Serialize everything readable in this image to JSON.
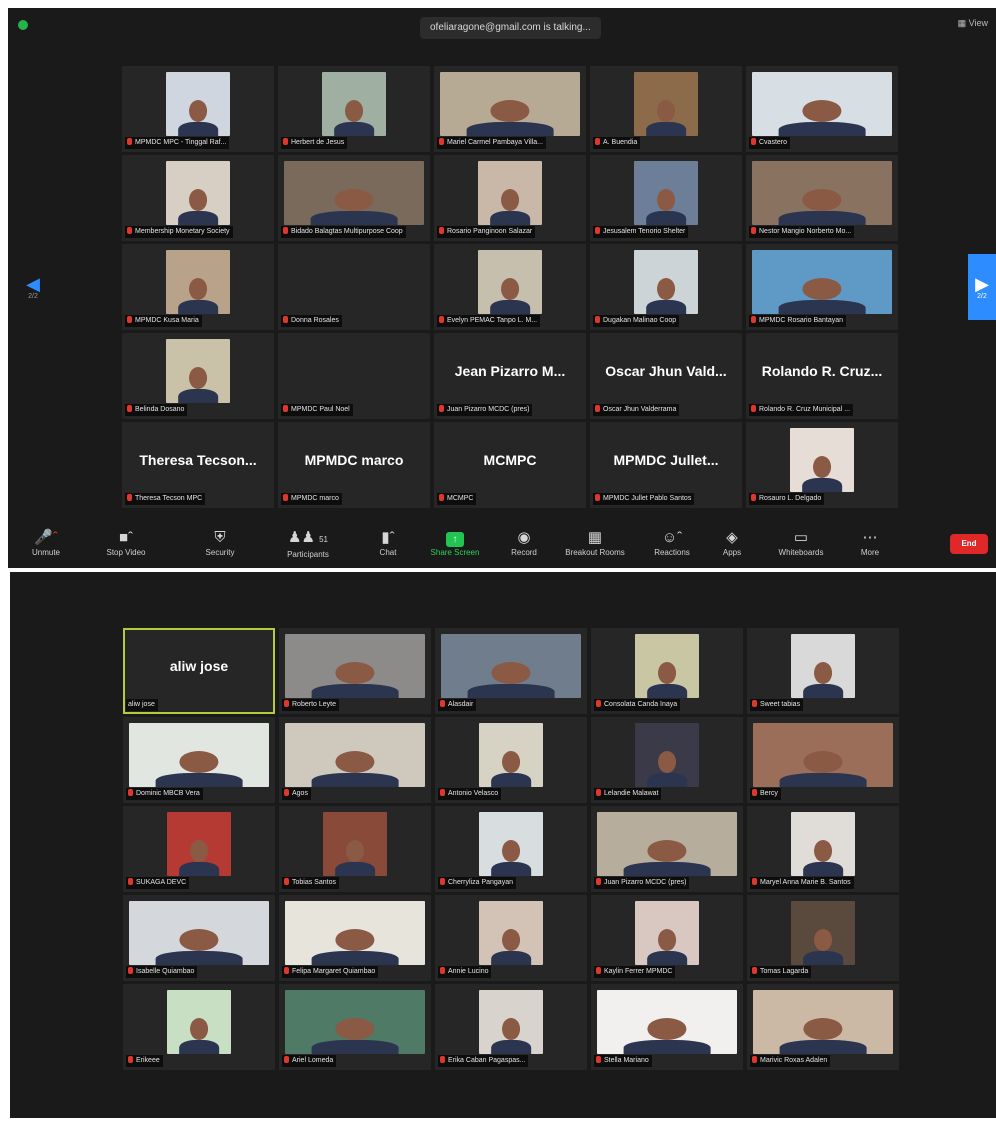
{
  "meeting": {
    "speaking_indicator": "ofeliaragone@gmail.com is talking...",
    "view_label": "View",
    "page_left": "2/2",
    "page_right": "2/2"
  },
  "toolbar": {
    "unmute": "Unmute",
    "stop_video": "Stop Video",
    "security": "Security",
    "participants": "Participants",
    "participants_count": "51",
    "chat": "Chat",
    "share_screen": "Share Screen",
    "record": "Record",
    "breakout_rooms": "Breakout Rooms",
    "reactions": "Reactions",
    "apps": "Apps",
    "whiteboards": "Whiteboards",
    "more": "More",
    "end": "End"
  },
  "screen1_tiles": [
    {
      "name": "MPMDC MPC - Tinggal Raf...",
      "video": true,
      "bg": "#cfd6df"
    },
    {
      "name": "Herbert de Jesus",
      "video": true,
      "bg": "#9fb0a2"
    },
    {
      "name": "Mariel Carmel Pambaya Villa...",
      "video": true,
      "bg": "#b7aa95",
      "wide": true
    },
    {
      "name": "A. Buendia",
      "video": true,
      "bg": "#8c6b4a"
    },
    {
      "name": "Cvastero",
      "video": true,
      "bg": "#d7dee4",
      "wide": true
    },
    {
      "name": "Membership Monetary Society",
      "video": true,
      "bg": "#d8cfc4"
    },
    {
      "name": "Bidado Balagtas Multipurpose Coop",
      "video": true,
      "bg": "#7a6a5c",
      "wide": true
    },
    {
      "name": "Rosario Panginoon Salazar",
      "video": true,
      "bg": "#c9b8a8"
    },
    {
      "name": "Jesusalem Tenorio Shelter",
      "video": true,
      "bg": "#6d7f98"
    },
    {
      "name": "Nestor Mangio Norberto Mo...",
      "video": true,
      "bg": "#8a7260",
      "wide": true
    },
    {
      "name": "MPMDC Kusa Maria",
      "video": true,
      "bg": "#b9a28a"
    },
    {
      "name": "Donna Rosales",
      "video": false
    },
    {
      "name": "Evelyn PEMAC Tanpo L. M...",
      "video": true,
      "bg": "#c7bfae"
    },
    {
      "name": "Dugakan Malinao Coop",
      "video": true,
      "bg": "#cdd4d8"
    },
    {
      "name": "MPMDC Rosario Bantayan",
      "video": true,
      "bg": "#5f9ac6",
      "wide": true
    },
    {
      "name": "Belinda Dosano",
      "video": true,
      "bg": "#c9c1a8"
    },
    {
      "name": "MPMDC Paul Noel",
      "video": false
    },
    {
      "name": "Juan Pizarro MCDC (pres)",
      "big": "Jean Pizarro M..."
    },
    {
      "name": "Oscar Jhun Valderrama",
      "big": "Oscar Jhun Vald..."
    },
    {
      "name": "Rolando R. Cruz Municipal ...",
      "big": "Rolando R. Cruz..."
    },
    {
      "name": "Theresa Tecson MPC",
      "big": "Theresa Tecson..."
    },
    {
      "name": "MPMDC marco",
      "big": "MPMDC marco"
    },
    {
      "name": "MCMPC",
      "big": "MCMPC"
    },
    {
      "name": "MPMDC Jullet Pablo Santos",
      "big": "MPMDC Jullet..."
    },
    {
      "name": "Rosauro L. Delgado",
      "video": true,
      "bg": "#e6ddd6"
    }
  ],
  "screen2_tiles": [
    {
      "name": "aliw jose",
      "big": "aliw jose",
      "active": true
    },
    {
      "name": "Roberto Leyte",
      "video": true,
      "bg": "#8d8a8a",
      "wide": true
    },
    {
      "name": "Alasdair",
      "video": true,
      "bg": "#6f7d8c",
      "wide": true
    },
    {
      "name": "Consolata Canda Inaya",
      "video": true,
      "bg": "#c9c6a3"
    },
    {
      "name": "Sweet tabias",
      "video": true,
      "bg": "#d9d9d9"
    },
    {
      "name": "Dominic MBCB Vera",
      "video": true,
      "bg": "#e1e6e0",
      "wide": true
    },
    {
      "name": "Agos",
      "video": true,
      "bg": "#cfc8bc",
      "wide": true
    },
    {
      "name": "Antonio Velasco",
      "video": true,
      "bg": "#d6d2c4"
    },
    {
      "name": "Lelandie Malawat",
      "video": true,
      "bg": "#3a3a48"
    },
    {
      "name": "Bercy",
      "video": true,
      "bg": "#9a6e58",
      "wide": true
    },
    {
      "name": "SUKAGA DEVC",
      "video": true,
      "bg": "#b53a33"
    },
    {
      "name": "Tobias Santos",
      "video": true,
      "bg": "#8a4a3a"
    },
    {
      "name": "Cherryliza Pangayan",
      "video": true,
      "bg": "#d8dde0"
    },
    {
      "name": "Juan Pizarro MCDC (pres)",
      "video": true,
      "bg": "#b7ad9c",
      "wide": true
    },
    {
      "name": "Maryel Anna Marie B. Santos",
      "video": true,
      "bg": "#e0ddd8"
    },
    {
      "name": "Isabelle Quiambao",
      "video": true,
      "bg": "#d4d8dc",
      "wide": true
    },
    {
      "name": "Felipa Margaret Quiambao",
      "video": true,
      "bg": "#e7e4dc",
      "wide": true
    },
    {
      "name": "Annie Lucino",
      "video": true,
      "bg": "#d3c3b6"
    },
    {
      "name": "Kaylin Ferrer MPMDC",
      "video": true,
      "bg": "#d9c7c2"
    },
    {
      "name": "Tomas Lagarda",
      "video": true,
      "bg": "#5a4a3e"
    },
    {
      "name": "Erikeee",
      "video": true,
      "bg": "#c8dfc4"
    },
    {
      "name": "Ariel Lomeda",
      "video": true,
      "bg": "#4e7a66",
      "wide": true
    },
    {
      "name": "Erika Caban Pagaspas...",
      "video": true,
      "bg": "#d8d3cd"
    },
    {
      "name": "Stella Mariano",
      "video": true,
      "bg": "#f1f0ee",
      "wide": true
    },
    {
      "name": "Marivic Roxas Adalen",
      "video": true,
      "bg": "#ccb9a5",
      "wide": true
    }
  ]
}
